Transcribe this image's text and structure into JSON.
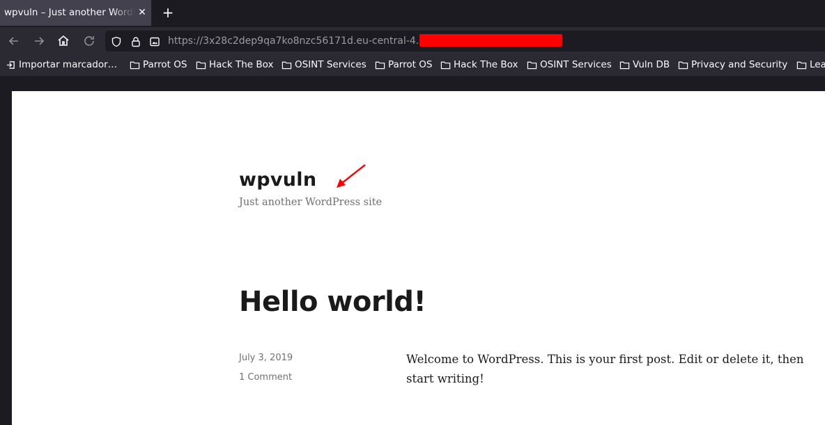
{
  "browser": {
    "tab": {
      "title": "wpvuln – Just another WordPress site"
    },
    "url": "https://3x28c2dep9qa7ko8nzc56171d.eu-central-4.",
    "bookmarks": [
      {
        "label": "Importar marcador…",
        "icon": "import-icon"
      },
      {
        "label": "Parrot OS",
        "icon": "folder-icon"
      },
      {
        "label": "Hack The Box",
        "icon": "folder-icon"
      },
      {
        "label": "OSINT Services",
        "icon": "folder-icon"
      },
      {
        "label": "Parrot OS",
        "icon": "folder-icon"
      },
      {
        "label": "Hack The Box",
        "icon": "folder-icon"
      },
      {
        "label": "OSINT Services",
        "icon": "folder-icon"
      },
      {
        "label": "Vuln DB",
        "icon": "folder-icon"
      },
      {
        "label": "Privacy and Security",
        "icon": "folder-icon"
      },
      {
        "label": "Lea",
        "icon": "folder-icon"
      }
    ],
    "colors": {
      "tab_active": "#42414d",
      "toolbar": "#2b2a33",
      "frame": "#1c1b22",
      "redaction": "#ff0000",
      "arrow": "#ff0000"
    }
  },
  "site": {
    "title": "wpvuln",
    "description": "Just another WordPress site"
  },
  "post": {
    "title": "Hello world!",
    "date": "July 3, 2019",
    "comments": "1 Comment",
    "body": "Welcome to WordPress. This is your first post. Edit or delete it, then start writing!"
  }
}
